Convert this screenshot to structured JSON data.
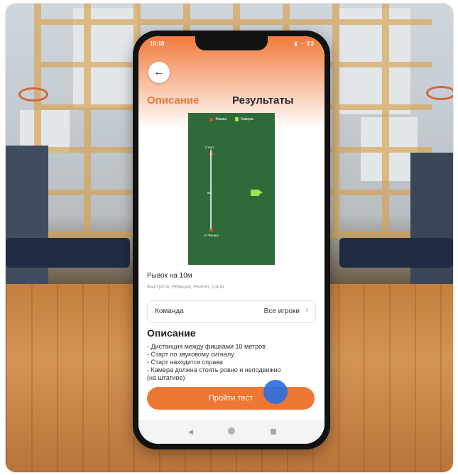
{
  "status_bar": {
    "time": "15:18",
    "right": "23"
  },
  "tabs": [
    {
      "label": "Описание",
      "active": true
    },
    {
      "label": "Результаты",
      "active": false
    }
  ],
  "field": {
    "legend": [
      {
        "icon": "cone-icon",
        "label": "Фишка"
      },
      {
        "icon": "camera-icon",
        "label": "Камера"
      }
    ],
    "marks": {
      "top": "Старт",
      "middle": "5м",
      "bottom": "10 Финиш"
    }
  },
  "test": {
    "title": "Рывок на 10м",
    "tags": "Быстрота, Реакция, Разгон, Сила"
  },
  "team_selector": {
    "label": "Команда",
    "value": "Все игроки"
  },
  "description": {
    "title": "Описание",
    "bullets": [
      "- Дистанция между фишками 10 метров",
      "- Старт по звуковому сигналу",
      "- Старт находится справа",
      "- Камера должна стоять ровно и неподвижно",
      "(на штативе)"
    ]
  },
  "cta": {
    "label": "Пройти тест"
  },
  "colors": {
    "accent": "#ee7734",
    "field": "#2e6b38",
    "touch": "#2f6fe0"
  }
}
